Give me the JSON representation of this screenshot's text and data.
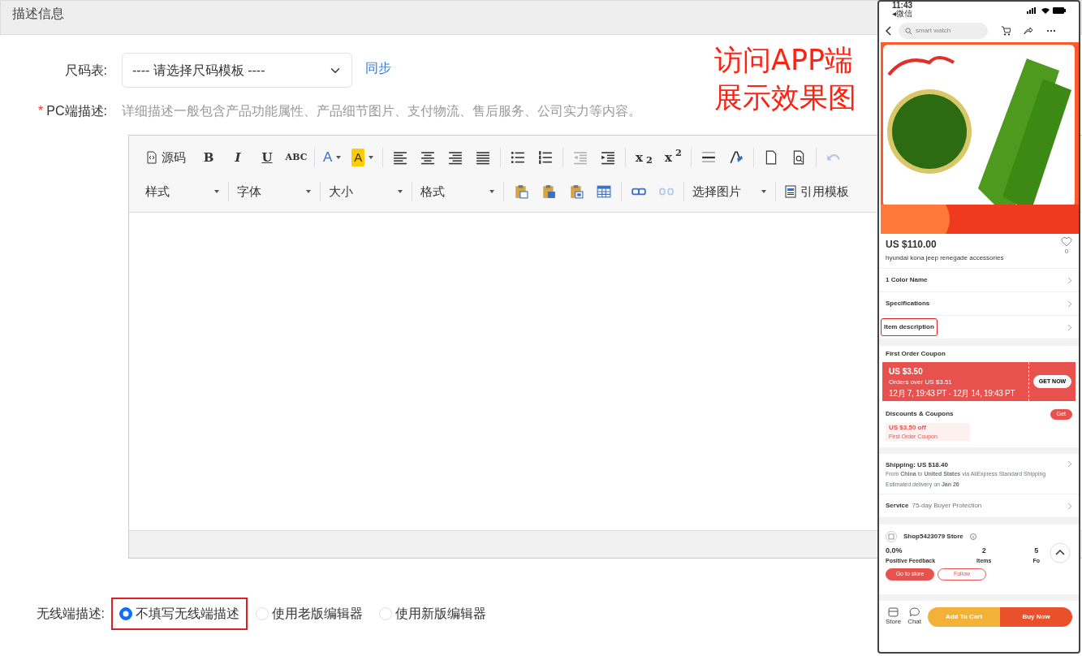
{
  "section_title": "描述信息",
  "size_chart": {
    "label": "尺码表:",
    "select_value": "---- 请选择尺码模板 ----",
    "sync_link": "同步"
  },
  "pc_description": {
    "required_mark": "*",
    "label": "PC端描述:",
    "hint": "详细描述一般包含产品功能属性、产品细节图片、支付物流、售后服务、公司实力等内容。"
  },
  "editor": {
    "toolbar_rows": [
      [
        [
          {
            "kind": "icon-label",
            "label": "源码",
            "disabled": false
          },
          {
            "kind": "letter",
            "label": "B",
            "disabled": false
          },
          {
            "kind": "letter",
            "label": "I",
            "disabled": false
          },
          {
            "kind": "letter",
            "label": "U",
            "disabled": false
          },
          {
            "kind": "letter",
            "label": "ABC",
            "disabled": false
          }
        ],
        [
          {
            "kind": "color",
            "label": "A",
            "disabled": false
          },
          {
            "kind": "highlight",
            "label": "A",
            "disabled": false
          }
        ],
        [
          {
            "kind": "icon",
            "disabled": false
          },
          {
            "kind": "icon",
            "disabled": false
          },
          {
            "kind": "icon",
            "disabled": false
          },
          {
            "kind": "icon",
            "disabled": false
          }
        ],
        [
          {
            "kind": "icon",
            "disabled": false
          },
          {
            "kind": "icon",
            "disabled": false
          }
        ],
        [
          {
            "kind": "icon",
            "disabled": true
          },
          {
            "kind": "icon",
            "disabled": false
          }
        ],
        [
          {
            "kind": "letter",
            "label": "x$_{2}$",
            "disabled": false
          },
          {
            "kind": "letter",
            "label": "x$^{2}$",
            "disabled": false
          }
        ],
        [
          {
            "kind": "icon",
            "disabled": false
          },
          {
            "kind": "icon",
            "disabled": false
          }
        ],
        [
          {
            "kind": "icon",
            "disabled": false
          },
          {
            "kind": "icon",
            "disabled": false
          }
        ],
        [
          {
            "kind": "icon",
            "disabled": true
          }
        ]
      ],
      [
        [
          {
            "kind": "dropdown",
            "label": "样式",
            "disabled": false
          }
        ],
        [
          {
            "kind": "dropdown",
            "label": "字体",
            "disabled": false
          }
        ],
        [
          {
            "kind": "dropdown",
            "label": "大小",
            "disabled": false
          }
        ],
        [
          {
            "kind": "dropdown",
            "label": "格式",
            "disabled": false
          }
        ],
        [
          {
            "kind": "icon",
            "disabled": false
          },
          {
            "kind": "icon",
            "disabled": false
          },
          {
            "kind": "icon",
            "disabled": false
          },
          {
            "kind": "icon",
            "disabled": false
          }
        ],
        [
          {
            "kind": "icon",
            "disabled": false
          },
          {
            "kind": "icon",
            "disabled": true
          }
        ],
        [
          {
            "kind": "dropdown",
            "label": "选择图片",
            "disabled": false
          }
        ],
        [
          {
            "kind": "icon-label",
            "label": "引用模板",
            "disabled": false
          }
        ]
      ]
    ]
  },
  "wireless_description": {
    "label": "无线端描述:",
    "options": [
      {
        "label": "不填写无线端描述",
        "selected": true,
        "boxed": true
      },
      {
        "label": "使用老版编辑器",
        "selected": false,
        "boxed": false
      },
      {
        "label": "使用新版编辑器",
        "selected": false,
        "boxed": false
      }
    ]
  },
  "annotation": {
    "lines": [
      "访问APP端",
      "展示效果图"
    ]
  },
  "phone": {
    "status_time": "11:43",
    "back_app": "◂微信",
    "search_placeholder": "smart watch",
    "price": "US $110.00",
    "wishlist_count": "0",
    "title": "hyundai kona  jeep renegade accessories",
    "rows": [
      {
        "label": "1 Color Name",
        "boxed": false
      },
      {
        "label": "Specifications",
        "boxed": false
      },
      {
        "label": "Item description",
        "boxed": true
      }
    ],
    "coupon": {
      "heading": "First Order Coupon",
      "amount": "US $3.50",
      "condition": "Orders over US $3.51",
      "period": "12月 7, 19:43 PT - 12月 14, 19:43 PT",
      "button": "GET NOW"
    },
    "discounts": {
      "heading": "Discounts & Coupons",
      "get_button": "Get",
      "offer": "US $3.50 off",
      "offer_note": "First Order Coupon"
    },
    "shipping": {
      "heading": "Shipping: US $18.40",
      "route": "From **China** to **United States** via AliExpress Standard Shipping",
      "delivery": "Estimated delivery on **Jan 26**"
    },
    "service": {
      "label": "Service",
      "value": "75-day Buyer Protection"
    },
    "store": {
      "name": "Shop5423079 Store",
      "stats": [
        {
          "value": "0.0%",
          "label": "Positive Feedback"
        },
        {
          "value": "2",
          "label": "Items"
        },
        {
          "value": "5",
          "label": "Fo"
        }
      ],
      "buttons": [
        {
          "label": "Go to store",
          "kind": "filled"
        },
        {
          "label": "Follow",
          "kind": "outline"
        }
      ]
    },
    "bottom_bar": {
      "icons": [
        {
          "label": "Store"
        },
        {
          "label": "Chat"
        }
      ],
      "add_to_cart": "Add To Cart",
      "buy_now": "Buy Now"
    }
  }
}
